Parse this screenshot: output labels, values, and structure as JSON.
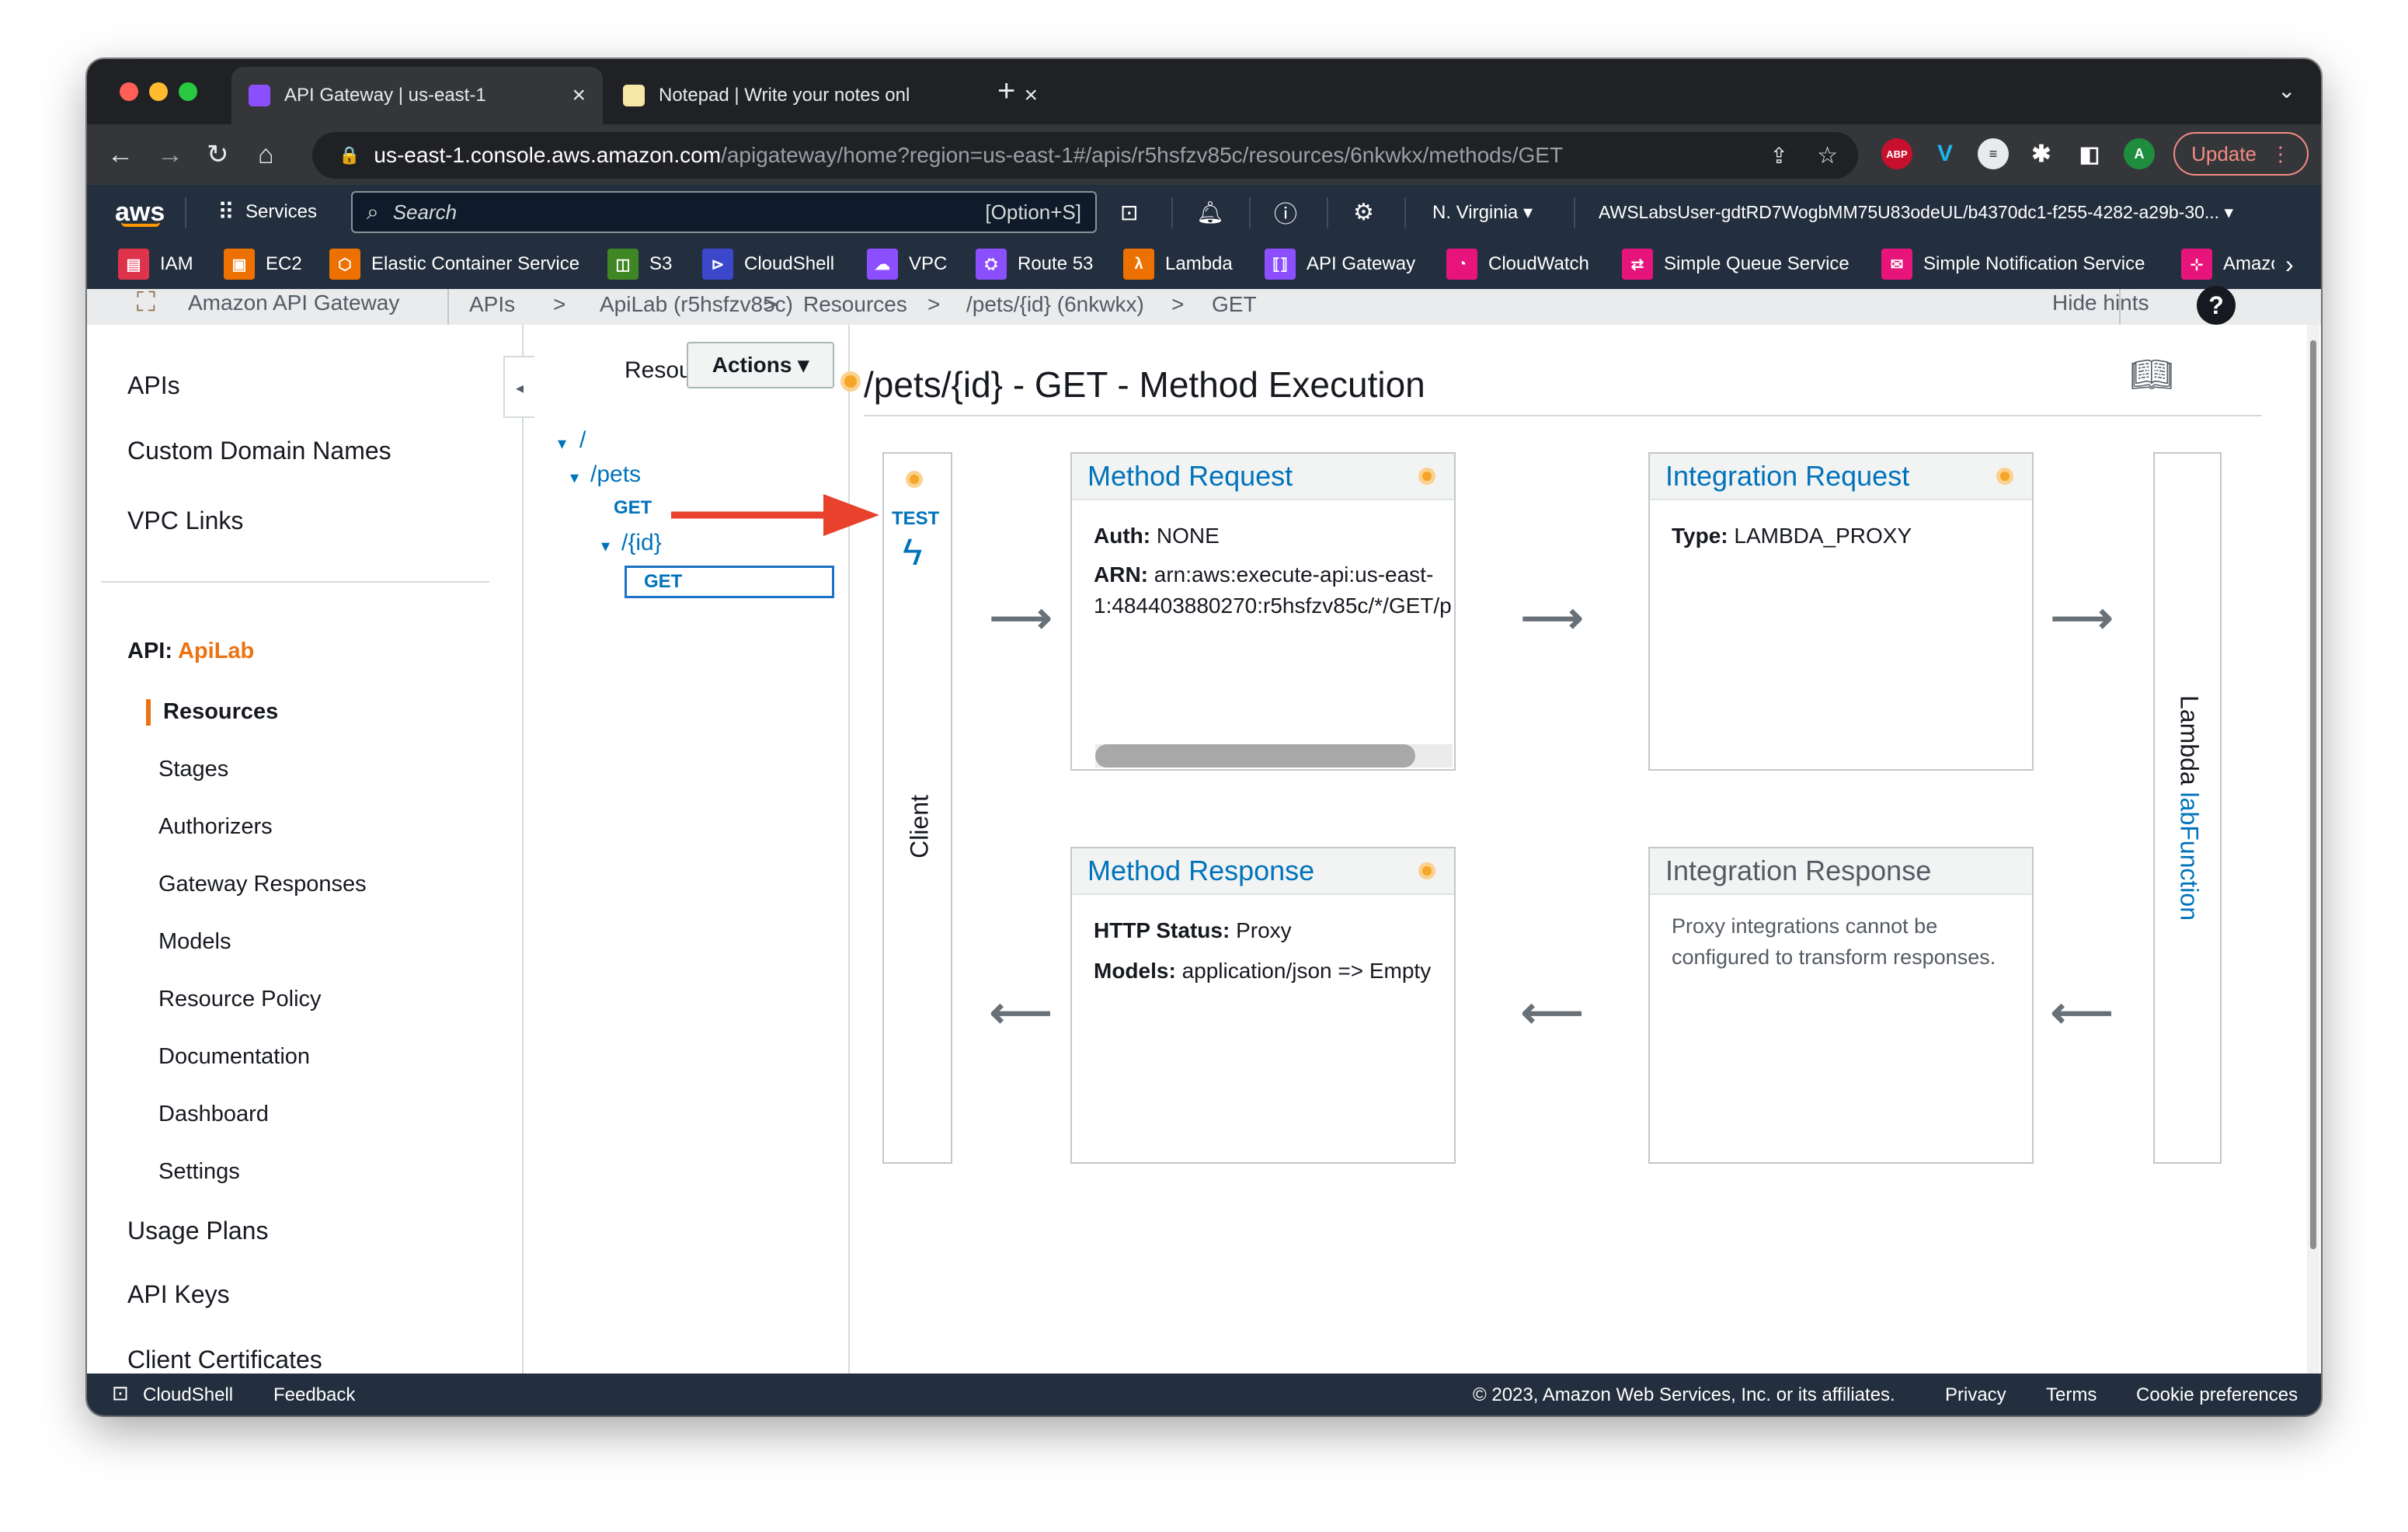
{
  "browser": {
    "tabs": [
      {
        "label": "API Gateway | us-east-1"
      },
      {
        "label": "Notepad | Write your notes onl"
      }
    ],
    "url_host": "us-east-1.console.aws.amazon.com",
    "url_path": "/apigateway/home?region=us-east-1#/apis/r5hsfzv85c/resources/6nkwkx/methods/GET",
    "update_label": "Update",
    "profile_initial": "A"
  },
  "aws_nav": {
    "logo": "aws",
    "services": "Services",
    "search_placeholder": "Search",
    "search_shortcut": "[Option+S]",
    "region": "N. Virginia ▾",
    "account": "AWSLabsUser-gdtRD7WogbMM75U83odeUL/b4370dc1-f255-4282-a29b-30... ▾",
    "favorites": [
      "IAM",
      "EC2",
      "Elastic Container Service",
      "S3",
      "CloudShell",
      "VPC",
      "Route 53",
      "Lambda",
      "API Gateway",
      "CloudWatch",
      "Simple Queue Service",
      "Simple Notification Service",
      "Amazo"
    ]
  },
  "breadcrumb": {
    "service": "Amazon API Gateway",
    "items": [
      "APIs",
      ">",
      "ApiLab (r5hsfzv85c)",
      ">",
      "Resources",
      ">",
      "/pets/{id} (6nkwkx)",
      ">",
      "GET"
    ],
    "hide_hints": "Hide hints",
    "help": "?"
  },
  "sidebar": {
    "top": [
      "APIs",
      "Custom Domain Names",
      "VPC Links"
    ],
    "api_label": "API:",
    "api_name": "ApiLab",
    "sub": [
      "Resources",
      "Stages",
      "Authorizers",
      "Gateway Responses",
      "Models",
      "Resource Policy",
      "Documentation",
      "Dashboard",
      "Settings"
    ],
    "bottom": [
      "Usage Plans",
      "API Keys",
      "Client Certificates"
    ]
  },
  "resources": {
    "title": "Resources",
    "actions": "Actions ▾",
    "tree": [
      "/",
      "/pets",
      "GET",
      "/{id}",
      "GET"
    ]
  },
  "method": {
    "title": "/pets/{id} - GET - Method Execution",
    "test_label": "TEST",
    "client_label": "Client",
    "method_request": {
      "title": "Method Request",
      "auth_key": "Auth:",
      "auth_val": "NONE",
      "arn_key": "ARN:",
      "arn_val_1": "arn:aws:execute-api:us-east-",
      "arn_val_2": "1:484403880270:r5hsfzv85c/*/GET/p"
    },
    "integration_request": {
      "title": "Integration Request",
      "type_key": "Type:",
      "type_val": "LAMBDA_PROXY"
    },
    "method_response": {
      "title": "Method Response",
      "status_key": "HTTP Status:",
      "status_val": "Proxy",
      "models_key": "Models:",
      "models_val": "application/json => Empty"
    },
    "integration_response": {
      "title": "Integration Response",
      "text_1": "Proxy integrations cannot be",
      "text_2": "configured to transform responses."
    },
    "lambda_prefix": "Lambda",
    "lambda_name": "labFunction"
  },
  "footer": {
    "cloudshell": "CloudShell",
    "feedback": "Feedback",
    "copyright": "© 2023, Amazon Web Services, Inc. or its affiliates.",
    "privacy": "Privacy",
    "terms": "Terms",
    "cookies": "Cookie preferences"
  },
  "colors": {
    "aws_orange": "#ec7211",
    "link_blue": "#0073bb",
    "nav_dark": "#232f3e",
    "annotation_red": "#e8412c"
  }
}
